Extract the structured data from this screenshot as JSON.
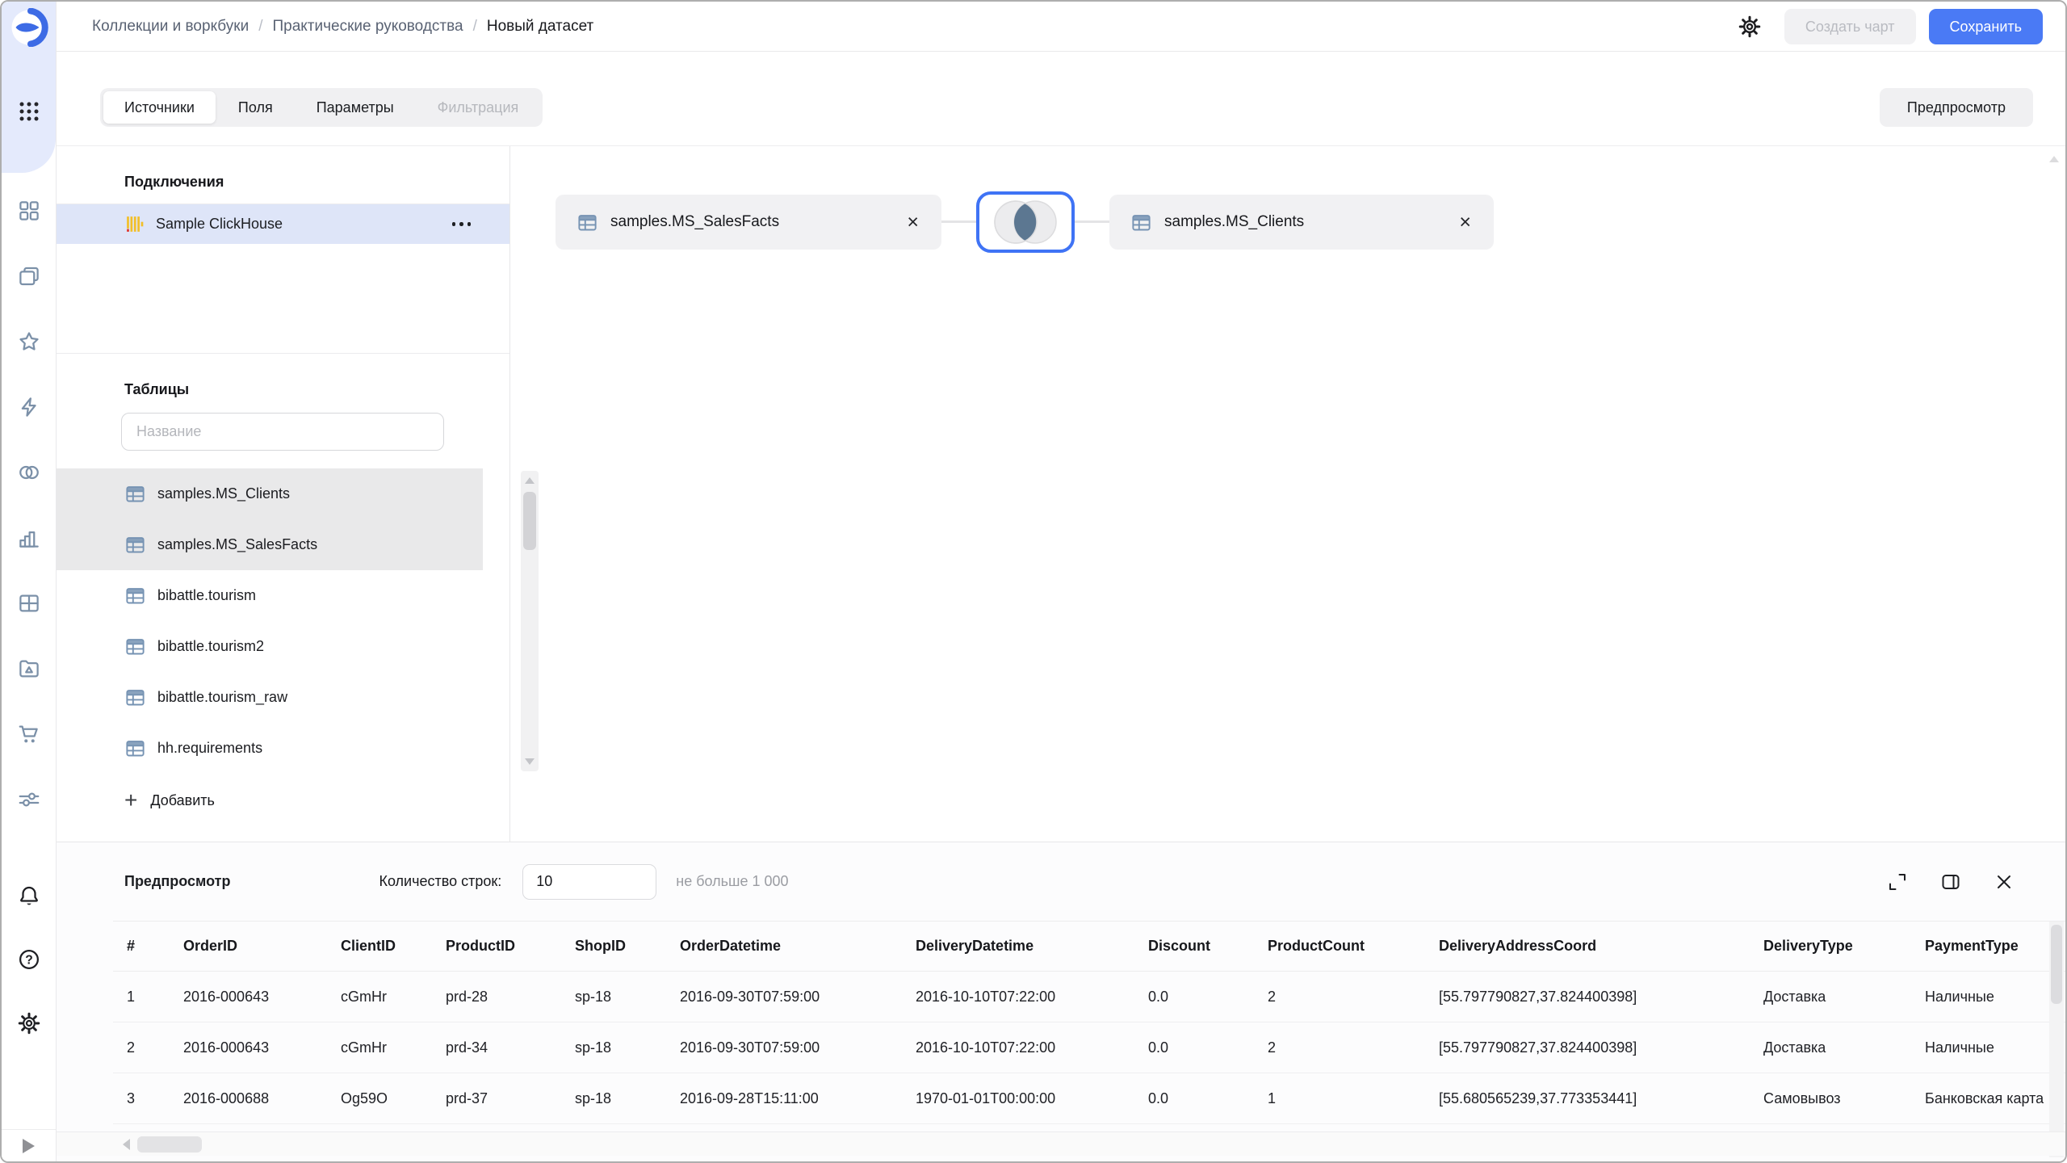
{
  "header": {
    "breadcrumbs": [
      "Коллекции и воркбуки",
      "Практические руководства",
      "Новый датасет"
    ],
    "create_chart_label": "Создать чарт",
    "save_label": "Сохранить"
  },
  "tabs": {
    "items": [
      "Источники",
      "Поля",
      "Параметры",
      "Фильтрация"
    ],
    "active": "Источники",
    "disabled": "Фильтрация",
    "preview_button_label": "Предпросмотр"
  },
  "connections": {
    "title": "Подключения",
    "items": [
      {
        "name": "Sample ClickHouse",
        "selected": true
      }
    ]
  },
  "tables_panel": {
    "title": "Таблицы",
    "search_placeholder": "Название",
    "items": [
      {
        "name": "samples.MS_Clients",
        "used": true
      },
      {
        "name": "samples.MS_SalesFacts",
        "used": true
      },
      {
        "name": "bibattle.tourism",
        "used": false
      },
      {
        "name": "bibattle.tourism2",
        "used": false
      },
      {
        "name": "bibattle.tourism_raw",
        "used": false
      },
      {
        "name": "hh.requirements",
        "used": false
      }
    ],
    "add_label": "Добавить"
  },
  "canvas": {
    "nodes": [
      {
        "name": "samples.MS_SalesFacts"
      },
      {
        "name": "samples.MS_Clients"
      }
    ],
    "join_type": "inner"
  },
  "preview": {
    "title": "Предпросмотр",
    "row_count_label": "Количество строк:",
    "row_count_value": "10",
    "row_count_hint": "не больше 1 000",
    "table": {
      "columns": [
        "#",
        "OrderID",
        "ClientID",
        "ProductID",
        "ShopID",
        "OrderDatetime",
        "DeliveryDatetime",
        "Discount",
        "ProductCount",
        "DeliveryAddressCoord",
        "DeliveryType",
        "PaymentType"
      ],
      "rows": [
        [
          "1",
          "2016-000643",
          "cGmHr",
          "prd-28",
          "sp-18",
          "2016-09-30T07:59:00",
          "2016-10-10T07:22:00",
          "0.0",
          "2",
          "[55.797790827,37.824400398]",
          "Доставка",
          "Наличные"
        ],
        [
          "2",
          "2016-000643",
          "cGmHr",
          "prd-34",
          "sp-18",
          "2016-09-30T07:59:00",
          "2016-10-10T07:22:00",
          "0.0",
          "2",
          "[55.797790827,37.824400398]",
          "Доставка",
          "Наличные"
        ],
        [
          "3",
          "2016-000688",
          "Og59O",
          "prd-37",
          "sp-18",
          "2016-09-28T15:11:00",
          "1970-01-01T00:00:00",
          "0.0",
          "1",
          "[55.680565239,37.773353441]",
          "Самовывоз",
          "Банковская карта"
        ]
      ]
    }
  },
  "sidebar_icons": [
    "datalens-logo",
    "apps-grid-icon",
    "collections-icon",
    "workbooks-icon",
    "favorites-icon",
    "quick-actions-icon",
    "datasets-icon",
    "charts-icon",
    "dashboards-icon",
    "gallery-icon",
    "marketplace-icon",
    "services-icon",
    "notifications-bell-icon",
    "help-icon",
    "settings-gear-icon",
    "expand-sidebar-icon"
  ],
  "colors": {
    "accent_blue": "#4a7af5",
    "join_border_blue": "#3f73f5",
    "join_intersection": "#5c7791",
    "selected_connection_bg": "#dee5f8",
    "used_table_bg": "#e9e9ea",
    "sidebar_top_bg": "#e4eafc",
    "clickhouse_yellow": "#f2bf29",
    "clickhouse_red": "#e0332b",
    "table_icon_blue": "#7693b3"
  }
}
